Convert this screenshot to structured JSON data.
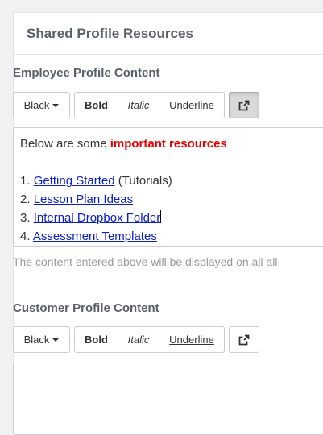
{
  "panel": {
    "title": "Shared Profile Resources"
  },
  "employee": {
    "section_title": "Employee Profile Content",
    "toolbar": {
      "color_label": "Black",
      "bold_label": "Bold",
      "italic_label": "Italic",
      "underline_label": "Underline",
      "link_icon": "share-icon"
    },
    "content": {
      "intro_prefix": "Below are some ",
      "intro_emphasis": "important resources",
      "emphasis_color": "#e60000",
      "items": [
        {
          "number": "1.",
          "link": "Getting Started",
          "suffix": " (Tutorials)"
        },
        {
          "number": "2.",
          "link": "Lesson Plan Ideas",
          "suffix": ""
        },
        {
          "number": "3.",
          "link": "Internal Dropbox Folder",
          "suffix": ""
        },
        {
          "number": "4.",
          "link": "Assessment Templates",
          "suffix": ""
        }
      ]
    },
    "help_text": "The content entered above will be displayed on all all"
  },
  "customer": {
    "section_title": "Customer Profile Content",
    "toolbar": {
      "color_label": "Black",
      "bold_label": "Bold",
      "italic_label": "Italic",
      "underline_label": "Underline",
      "link_icon": "share-icon"
    },
    "content": ""
  }
}
